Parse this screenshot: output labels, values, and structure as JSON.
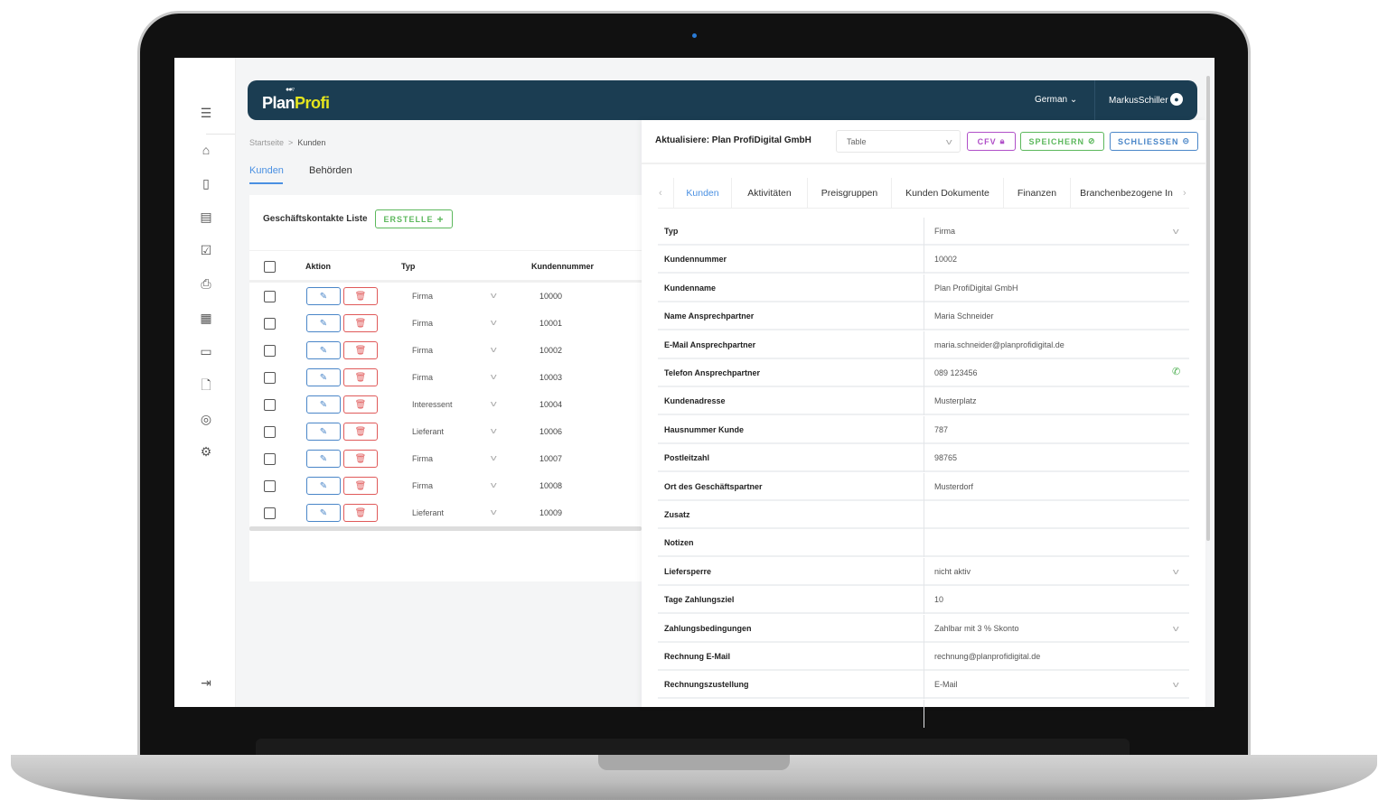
{
  "app": {
    "logo_part1": "Plan",
    "logo_part2": "Profi",
    "language": "German",
    "user": "MarkusSchiller"
  },
  "colors": {
    "header": "#1b3d52",
    "accent": "#4a90e2",
    "success": "#4caf50",
    "danger": "#e05a5a",
    "purple": "#b04fc8"
  },
  "sidebar": {
    "icons": [
      "menu-icon",
      "factory-icon",
      "clipboard-icon",
      "invoice-icon",
      "clipboard-check-icon",
      "printer-icon",
      "calendar-icon",
      "chat-icon",
      "document-icon",
      "globe-icon",
      "settings-icon",
      "logout-icon"
    ]
  },
  "breadcrumb": {
    "home": "Startseite",
    "sep": ">",
    "current": "Kunden"
  },
  "tabs": [
    {
      "label": "Kunden",
      "active": true
    },
    {
      "label": "Behörden",
      "active": false
    }
  ],
  "list": {
    "title": "Geschäftskontakte Liste",
    "create_label": "ERSTELLE",
    "columns": [
      "Aktion",
      "Typ",
      "Kundennummer"
    ],
    "rows": [
      {
        "typ": "Firma",
        "nr": "10000"
      },
      {
        "typ": "Firma",
        "nr": "10001"
      },
      {
        "typ": "Firma",
        "nr": "10002"
      },
      {
        "typ": "Firma",
        "nr": "10003"
      },
      {
        "typ": "Interessent",
        "nr": "10004"
      },
      {
        "typ": "Lieferant",
        "nr": "10006"
      },
      {
        "typ": "Firma",
        "nr": "10007"
      },
      {
        "typ": "Firma",
        "nr": "10008"
      },
      {
        "typ": "Lieferant",
        "nr": "10009"
      }
    ]
  },
  "detail": {
    "title": "Aktualisiere: Plan ProfiDigital GmbH",
    "view_select": "Table",
    "cfv_label": "CFV",
    "save_label": "SPEICHERN",
    "close_label": "SCHLIESSEN",
    "tabs": [
      "Kunden",
      "Aktivitäten",
      "Preisgruppen",
      "Kunden Dokumente",
      "Finanzen",
      "Branchenbezogene In"
    ],
    "fields": [
      {
        "label": "Typ",
        "value": "Firma",
        "select": true
      },
      {
        "label": "Kundennummer",
        "value": "10002"
      },
      {
        "label": "Kundenname",
        "value": "Plan ProfiDigital GmbH"
      },
      {
        "label": "Name Ansprechpartner",
        "value": "Maria Schneider"
      },
      {
        "label": "E-Mail Ansprechpartner",
        "value": "maria.schneider@planprofidigital.de"
      },
      {
        "label": "Telefon Ansprechpartner",
        "value": "089 123456",
        "phone": true
      },
      {
        "label": "Kundenadresse",
        "value": "Musterplatz"
      },
      {
        "label": "Hausnummer Kunde",
        "value": "787"
      },
      {
        "label": "Postleitzahl",
        "value": "98765"
      },
      {
        "label": "Ort des Geschäftspartner",
        "value": "Musterdorf"
      },
      {
        "label": "Zusatz",
        "value": ""
      },
      {
        "label": "Notizen",
        "value": ""
      },
      {
        "label": "Liefersperre",
        "value": "nicht aktiv",
        "select": true
      },
      {
        "label": "Tage Zahlungsziel",
        "value": "10"
      },
      {
        "label": "Zahlungsbedingungen",
        "value": "Zahlbar mit 3 % Skonto",
        "select": true
      },
      {
        "label": "Rechnung E-Mail",
        "value": "rechnung@planprofidigital.de"
      },
      {
        "label": "Rechnungszustellung",
        "value": "E-Mail",
        "select": true
      }
    ]
  }
}
